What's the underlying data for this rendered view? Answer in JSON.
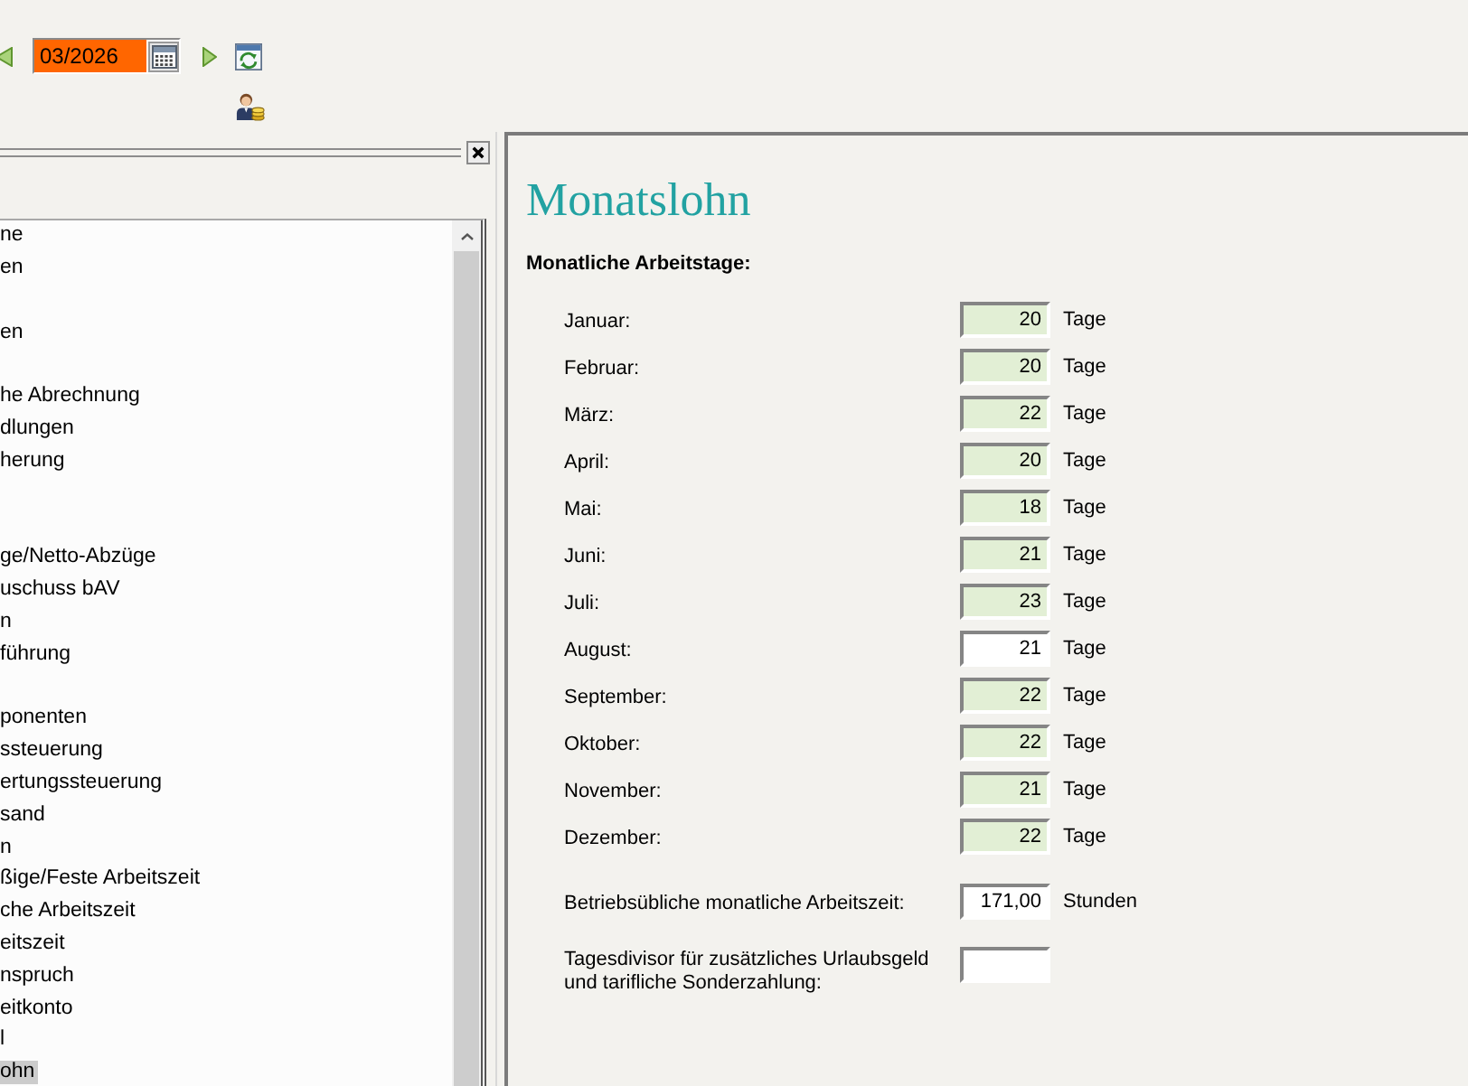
{
  "toolbar": {
    "period": "03/2026"
  },
  "sidebar": {
    "items": [
      {
        "label": "ne",
        "selected": false
      },
      {
        "label": "en",
        "selected": false
      },
      {
        "selected": false
      },
      {
        "label": "en",
        "selected": false
      },
      {
        "selected": false
      },
      {
        "label": "he Abrechnung",
        "selected": false
      },
      {
        "label": "dlungen",
        "selected": false
      },
      {
        "label": "herung",
        "selected": false
      },
      {
        "selected": false
      },
      {
        "selected": false
      },
      {
        "label": "ge/Netto-Abzüge",
        "selected": false
      },
      {
        "label": "uschuss bAV",
        "selected": false
      },
      {
        "label": "n",
        "selected": false
      },
      {
        "label": "führung",
        "selected": false
      },
      {
        "selected": false
      },
      {
        "label": "ponenten",
        "selected": false
      },
      {
        "label": "ssteuerung",
        "selected": false
      },
      {
        "label": "ertungssteuerung",
        "selected": false
      },
      {
        "label": "sand",
        "selected": false
      },
      {
        "label": "n",
        "selected": false
      },
      {
        "label": "ßige/Feste Arbeitszeit",
        "selected": false
      },
      {
        "label": "che Arbeitszeit",
        "selected": false
      },
      {
        "label": "eitszeit",
        "selected": false
      },
      {
        "label": "nspruch",
        "selected": false
      },
      {
        "label": "eitkonto",
        "selected": false
      },
      {
        "label": "l",
        "selected": false
      },
      {
        "label": "ohn",
        "selected": true
      }
    ]
  },
  "form": {
    "title": "Monatslohn",
    "section": "Monatliche Arbeitstage:",
    "months": [
      {
        "label": "Januar:",
        "value": "20",
        "unit": "Tage",
        "highlighted": true
      },
      {
        "label": "Februar:",
        "value": "20",
        "unit": "Tage",
        "highlighted": true
      },
      {
        "label": "März:",
        "value": "22",
        "unit": "Tage",
        "highlighted": true
      },
      {
        "label": "April:",
        "value": "20",
        "unit": "Tage",
        "highlighted": true
      },
      {
        "label": "Mai:",
        "value": "18",
        "unit": "Tage",
        "highlighted": true
      },
      {
        "label": "Juni:",
        "value": "21",
        "unit": "Tage",
        "highlighted": true
      },
      {
        "label": "Juli:",
        "value": "23",
        "unit": "Tage",
        "highlighted": true
      },
      {
        "label": "August:",
        "value": "21",
        "unit": "Tage",
        "highlighted": false
      },
      {
        "label": "September:",
        "value": "22",
        "unit": "Tage",
        "highlighted": true
      },
      {
        "label": "Oktober:",
        "value": "22",
        "unit": "Tage",
        "highlighted": true
      },
      {
        "label": "November:",
        "value": "21",
        "unit": "Tage",
        "highlighted": true
      },
      {
        "label": "Dezember:",
        "value": "22",
        "unit": "Tage",
        "highlighted": true
      }
    ],
    "hours": {
      "label": "Betriebsübliche monatliche Arbeitszeit:",
      "value": "171,00",
      "unit": "Stunden"
    },
    "divisor": {
      "label": "Tagesdivisor für zusätzliches Urlaubsgeld und tarifliche Sonderzahlung:"
    }
  }
}
